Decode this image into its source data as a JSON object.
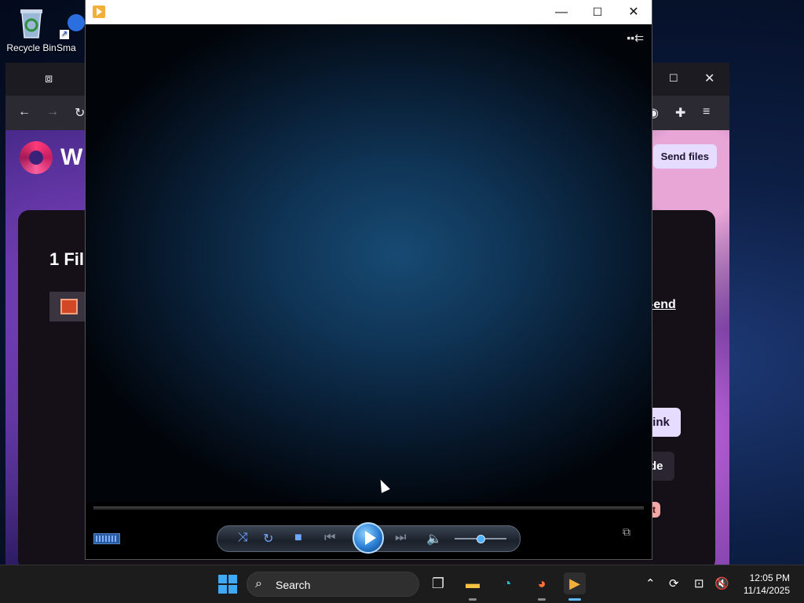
{
  "desktop": {
    "icons": [
      {
        "label": "Recycle Bin",
        "icon": "recycle-bin-icon"
      },
      {
        "label": "Sma",
        "icon": "shortcut-icon"
      }
    ]
  },
  "browser": {
    "site": {
      "logo_text": "W",
      "send_files": "Send files",
      "files_title": "1 Fil",
      "right_heading": "-end",
      "link_button": "link",
      "code_button": "de",
      "report_badge": "ort"
    }
  },
  "player": {
    "title": "",
    "colors": {
      "accent": "#2a7fd4",
      "video_bg": "#0f3455"
    },
    "volume": 0.5,
    "progress": 0.0
  },
  "taskbar": {
    "search_label": "Search",
    "time": "12:05 PM",
    "date": "11/14/2025",
    "colors": {
      "start": "#3fa9f5"
    }
  }
}
